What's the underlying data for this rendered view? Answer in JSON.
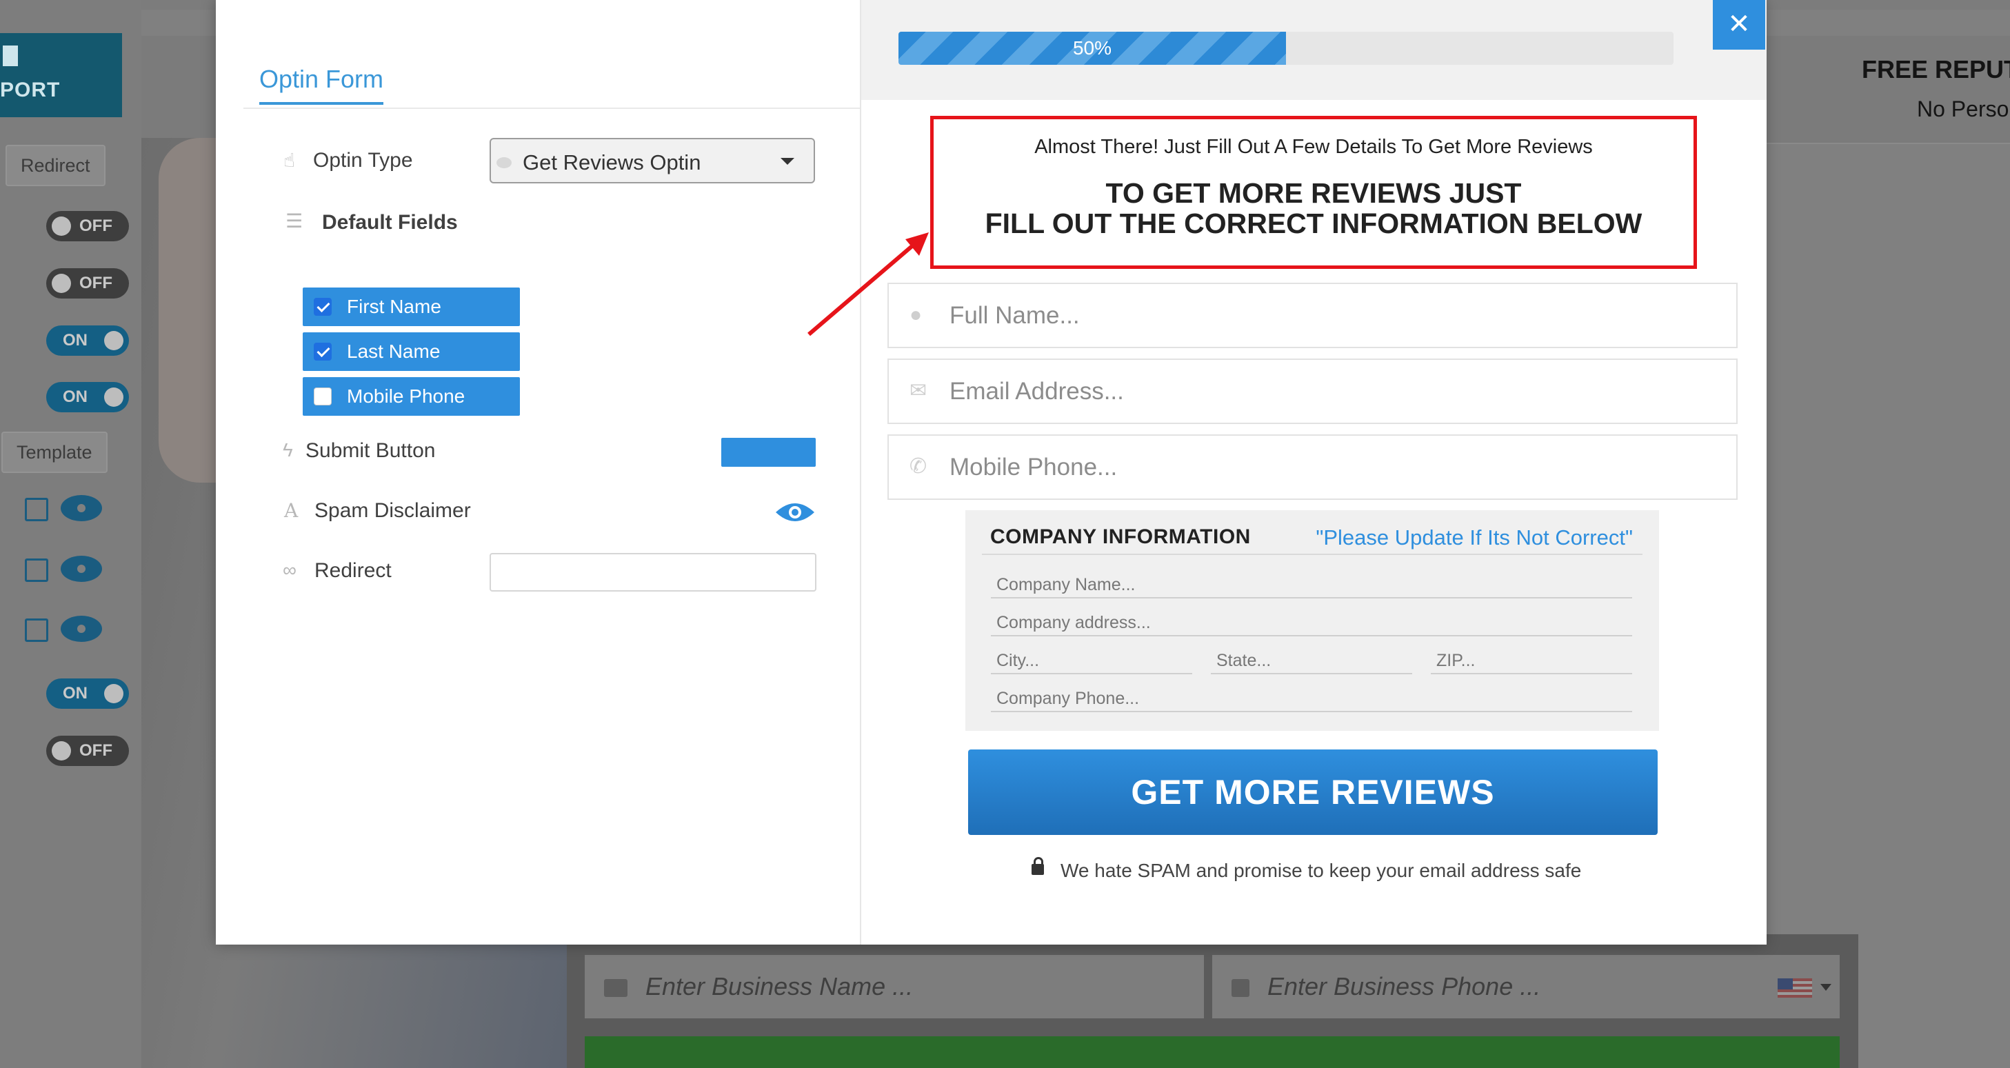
{
  "background": {
    "sidebar": {
      "report_label": "PORT",
      "redirect_tab": "Redirect",
      "template_tab": "Template",
      "toggles": [
        "OFF",
        "OFF",
        "ON",
        "ON"
      ],
      "toggles_bottom": [
        "ON",
        "OFF"
      ]
    },
    "right_header": {
      "title": "FREE REPUT",
      "subtitle": "No Perso"
    },
    "bottom_inputs": {
      "business_name_placeholder": "Enter Business Name ...",
      "business_phone_placeholder": "Enter Business Phone ..."
    }
  },
  "modal": {
    "left": {
      "tab_label": "Optin Form",
      "optin_type_label": "Optin Type",
      "optin_type_value": "Get Reviews Optin",
      "default_fields_label": "Default Fields",
      "fields": [
        {
          "label": "First Name",
          "checked": true
        },
        {
          "label": "Last Name",
          "checked": true
        },
        {
          "label": "Mobile Phone",
          "checked": false
        }
      ],
      "submit_button_label": "Submit Button",
      "submit_button_color": "#2f8fde",
      "spam_disclaimer_label": "Spam Disclaimer",
      "redirect_label": "Redirect",
      "redirect_value": ""
    },
    "right": {
      "progress_text": "50%",
      "progress_value": 0.5,
      "close_label": "✕",
      "headline_sub": "Almost There! Just Fill Out A Few Details To Get More Reviews",
      "headline_line1": "TO GET MORE REVIEWS JUST",
      "headline_line2": "FILL OUT THE CORRECT INFORMATION BELOW",
      "inputs": {
        "full_name": "Full Name...",
        "email": "Email Address...",
        "mobile_phone": "Mobile Phone..."
      },
      "company": {
        "heading": "COMPANY INFORMATION",
        "notice": "\"Please Update If Its Not Correct\"",
        "company_name": "Company Name...",
        "company_address": "Company address...",
        "city": "City...",
        "state": "State...",
        "zip": "ZIP...",
        "company_phone": "Company Phone..."
      },
      "cta_label": "GET MORE REVIEWS",
      "spam_text": "We hate SPAM and promise to keep your email address safe"
    }
  },
  "colors": {
    "accent": "#2f8fde",
    "highlight_border": "#e6141a"
  }
}
